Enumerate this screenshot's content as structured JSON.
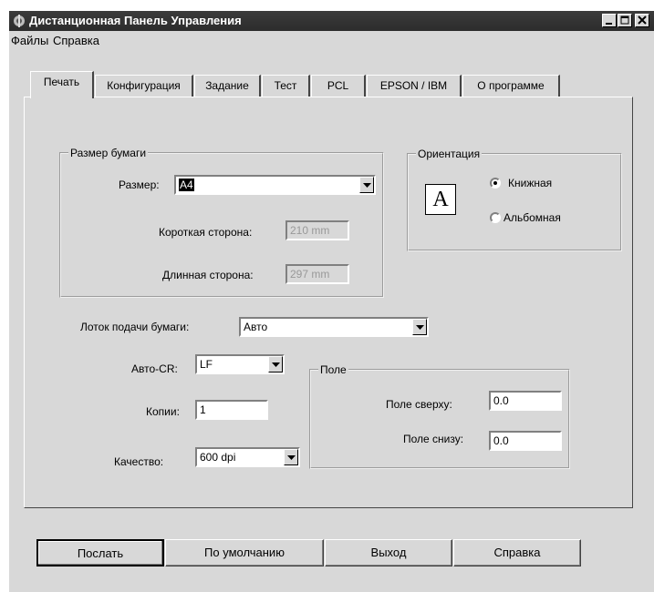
{
  "window": {
    "title": "Дистанционная Панель Управления",
    "controls": [
      "minimize-icon",
      "maximize-icon",
      "close-icon"
    ]
  },
  "menu": [
    "Файлы",
    "Справка"
  ],
  "tabs": [
    {
      "label": "Печать",
      "active": true
    },
    {
      "label": "Конфигурация",
      "active": false
    },
    {
      "label": "Задание",
      "active": false
    },
    {
      "label": "Тест",
      "active": false
    },
    {
      "label": "PCL",
      "active": false
    },
    {
      "label": "EPSON / IBM",
      "active": false
    },
    {
      "label": "О программе",
      "active": false
    }
  ],
  "paper_size": {
    "legend": "Размер бумаги",
    "size_label": "Размер:",
    "size_value": "A4",
    "short_label": "Короткая сторона:",
    "short_value": "210 mm",
    "long_label": "Длинная сторона:",
    "long_value": "297 mm"
  },
  "orientation": {
    "legend": "Ориентация",
    "icon_letter": "A",
    "portrait": "Книжная",
    "landscape": "Альбомная",
    "selected": "portrait"
  },
  "tray": {
    "label": "Лоток подачи бумаги:",
    "value": "Авто"
  },
  "auto_cr": {
    "label": "Авто-CR:",
    "value": "LF"
  },
  "copies": {
    "label": "Копии:",
    "value": "1"
  },
  "quality": {
    "label": "Качество:",
    "value": "600 dpi"
  },
  "margins": {
    "legend": "Поле",
    "top_label": "Поле сверху:",
    "top_value": "0.0",
    "bottom_label": "Поле снизу:",
    "bottom_value": "0.0"
  },
  "buttons": {
    "send": "Послать",
    "default": "По умолчанию",
    "exit": "Выход",
    "help": "Справка"
  },
  "colors": {
    "titlebar": "#333333",
    "face": "#d8d8d8"
  }
}
